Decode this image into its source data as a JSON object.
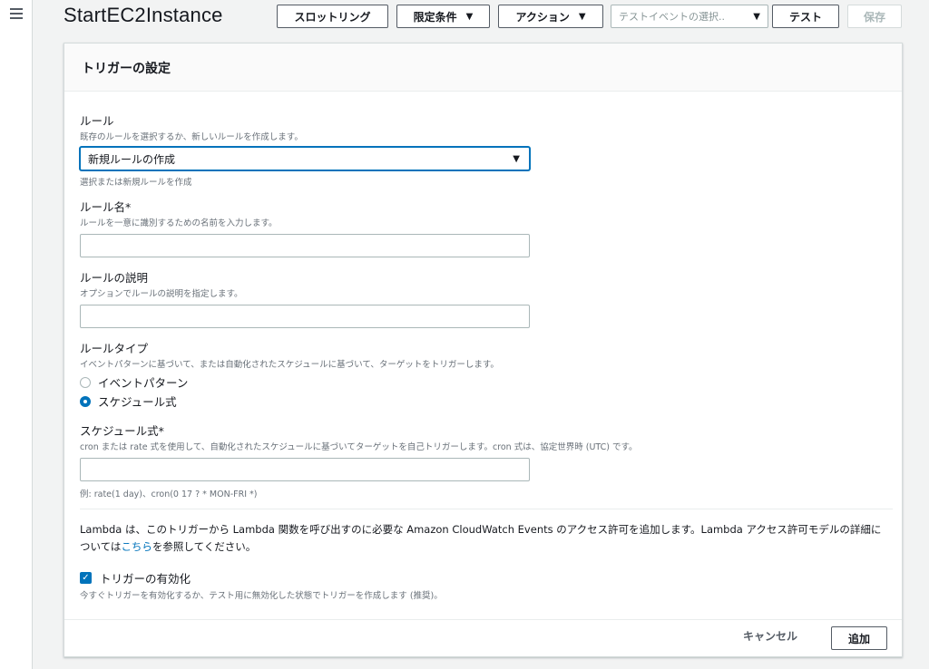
{
  "header": {
    "function_name": "StartEC2Instance",
    "throttling_label": "スロットリング",
    "qualifiers_label": "限定条件",
    "actions_label": "アクション",
    "test_event_placeholder": "テストイベントの選択..",
    "test_label": "テスト",
    "save_label": "保存"
  },
  "panel": {
    "title": "トリガーの設定",
    "rule": {
      "label": "ルール",
      "description": "既存のルールを選択するか、新しいルールを作成します。",
      "selected": "新規ルールの作成",
      "hint": "選択または新規ルールを作成"
    },
    "rule_name": {
      "label": "ルール名*",
      "description": "ルールを一意に識別するための名前を入力します。",
      "value": ""
    },
    "rule_description": {
      "label": "ルールの説明",
      "description": "オプションでルールの説明を指定します。",
      "value": ""
    },
    "rule_type": {
      "label": "ルールタイプ",
      "description": "イベントパターンに基づいて、または自動化されたスケジュールに基づいて、ターゲットをトリガーします。",
      "options": [
        {
          "label": "イベントパターン",
          "selected": false
        },
        {
          "label": "スケジュール式",
          "selected": true
        }
      ]
    },
    "schedule": {
      "label": "スケジュール式*",
      "description": "cron または rate 式を使用して、自動化されたスケジュールに基づいてターゲットを自己トリガーします。cron 式は、協定世界時 (UTC) です。",
      "value": "",
      "example": "例: rate(1 day)、cron(0 17 ? * MON-FRI *)"
    },
    "info": {
      "text_before": "Lambda は、このトリガーから Lambda 関数を呼び出すのに必要な Amazon CloudWatch Events のアクセス許可を追加します。Lambda アクセス許可モデルの詳細については",
      "link": "こちら",
      "text_after": "を参照してください。"
    },
    "enable": {
      "label": "トリガーの有効化",
      "checked": true,
      "description": "今すぐトリガーを有効化するか、テスト用に無効化した状態でトリガーを作成します (推奨)。"
    },
    "footer": {
      "cancel_label": "キャンセル",
      "add_label": "追加"
    }
  },
  "colors": {
    "accent": "#0073bb",
    "border": "#aab7b8",
    "background": "#f2f3f3"
  }
}
